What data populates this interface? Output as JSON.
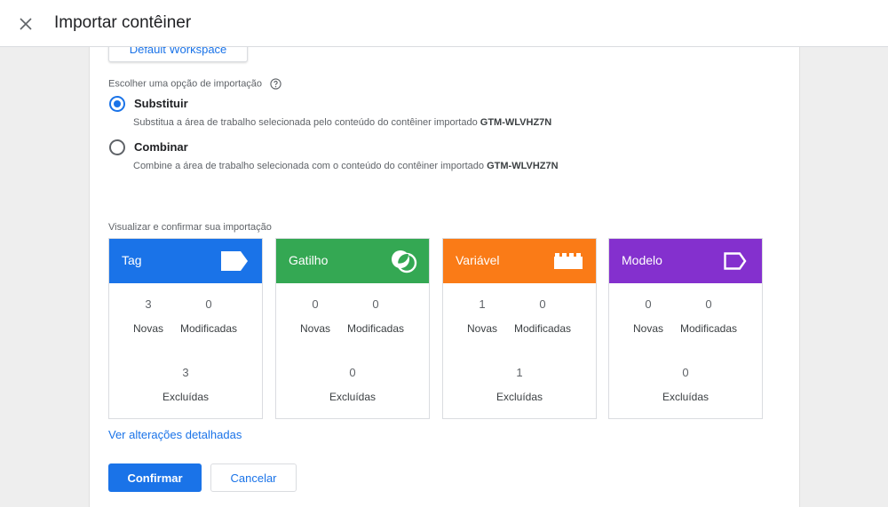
{
  "header": {
    "title": "Importar contêiner"
  },
  "workspace": {
    "button_label": "Default Workspace"
  },
  "import_option": {
    "label": "Escolher uma opção de importação",
    "options": [
      {
        "label": "Substituir",
        "desc_prefix": "Substitua a área de trabalho selecionada pelo conteúdo do contêiner importado",
        "container_id": "GTM-WLVHZ7N",
        "selected": true
      },
      {
        "label": "Combinar",
        "desc_prefix": "Combine a área de trabalho selecionada com o conteúdo do contêiner importado",
        "container_id": "GTM-WLVHZ7N",
        "selected": false
      }
    ]
  },
  "preview": {
    "label": "Visualizar e confirmar sua importação",
    "stat_labels": {
      "new": "Novas",
      "modified": "Modificadas",
      "deleted": "Excluídas"
    },
    "cards": [
      {
        "title": "Tag",
        "color": "#1a73e8",
        "icon": "tag-icon",
        "new": "3",
        "modified": "0",
        "deleted": "3"
      },
      {
        "title": "Gatilho",
        "color": "#34a853",
        "icon": "trigger-icon",
        "new": "0",
        "modified": "0",
        "deleted": "0"
      },
      {
        "title": "Variável",
        "color": "#fa7b17",
        "icon": "variable-icon",
        "new": "1",
        "modified": "0",
        "deleted": "1"
      },
      {
        "title": "Modelo",
        "color": "#8430ce",
        "icon": "template-icon",
        "new": "0",
        "modified": "0",
        "deleted": "0"
      }
    ]
  },
  "detail_link": "Ver alterações detalhadas",
  "actions": {
    "confirm": "Confirmar",
    "cancel": "Cancelar"
  }
}
